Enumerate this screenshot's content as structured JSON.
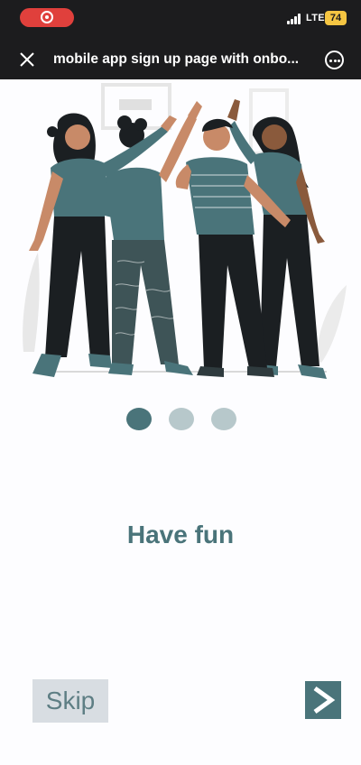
{
  "status_bar": {
    "network": "LTE",
    "battery": "74",
    "icons": [
      "record-icon",
      "signal-icon",
      "battery-icon"
    ]
  },
  "browser": {
    "title": "mobile app sign up page with onbo...",
    "icons": [
      "close-icon",
      "more-icon"
    ]
  },
  "onboarding": {
    "headline": "Have fun",
    "pager": {
      "total": 3,
      "active_index": 0
    },
    "skip_label": "Skip",
    "next_icon": "chevron-right-icon"
  },
  "colors": {
    "accent": "#4a747a",
    "dot_active": "#4a747a",
    "dot_inactive": "#b7c8cb",
    "skip_bg": "#d8dde2",
    "skip_text": "#5e7e84",
    "recording": "#e0403c",
    "battery": "#f5c542"
  }
}
